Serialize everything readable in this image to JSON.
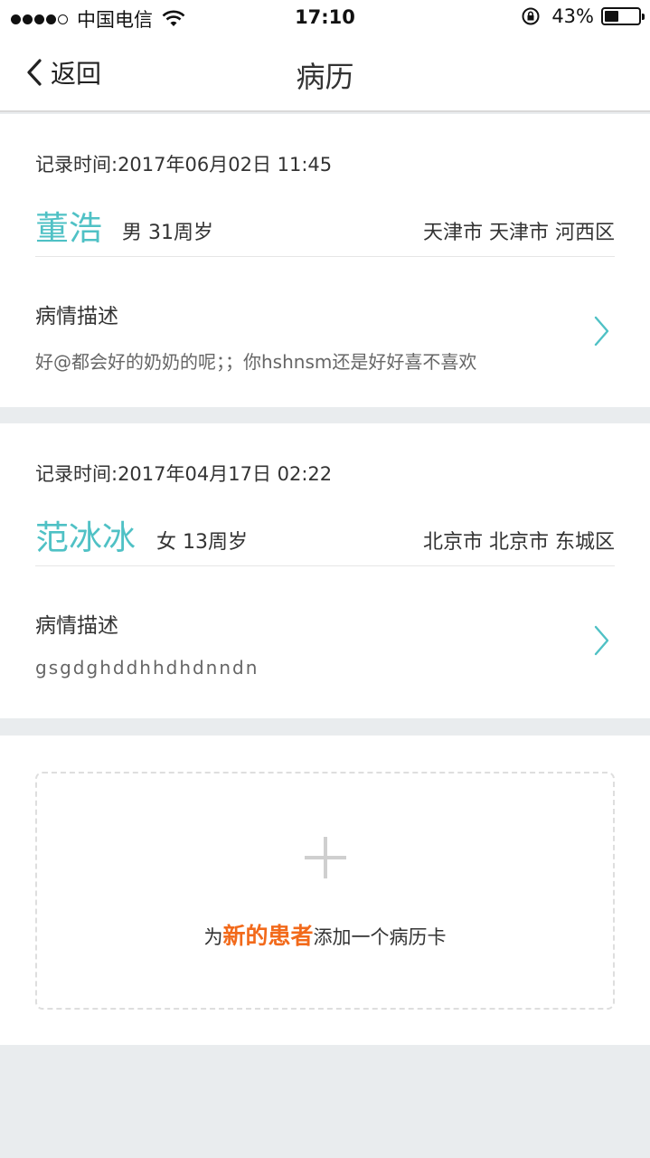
{
  "status_bar": {
    "carrier": "中国电信",
    "time": "17:10",
    "battery_percent": "43%",
    "battery_level": 0.43
  },
  "nav": {
    "back_label": "返回",
    "title": "病历"
  },
  "records": [
    {
      "record_time": "记录时间:2017年06月02日 11:45",
      "name": "董浩",
      "meta": "男 31周岁",
      "location": "天津市 天津市 河西区",
      "desc_title": "病情描述",
      "desc_text": "好@都会好的奶奶的呢；；你hshnsm还是好好喜不喜欢"
    },
    {
      "record_time": "记录时间:2017年04月17日 02:22",
      "name": "范冰冰",
      "meta": "女 13周岁",
      "location": "北京市 北京市 东城区",
      "desc_title": "病情描述",
      "desc_text": "gsgdghddhhdhdnndn"
    }
  ],
  "add_card": {
    "prefix": "为",
    "highlight": "新的患者",
    "suffix": "添加一个病历卡"
  },
  "colors": {
    "accent_teal": "#4fc1c5",
    "highlight_orange": "#f26a1b",
    "background_gray": "#e9ecee"
  },
  "icons": [
    "wifi-icon",
    "rotation-lock-icon",
    "battery-icon",
    "back-chevron-icon",
    "chevron-right-icon",
    "plus-icon"
  ]
}
